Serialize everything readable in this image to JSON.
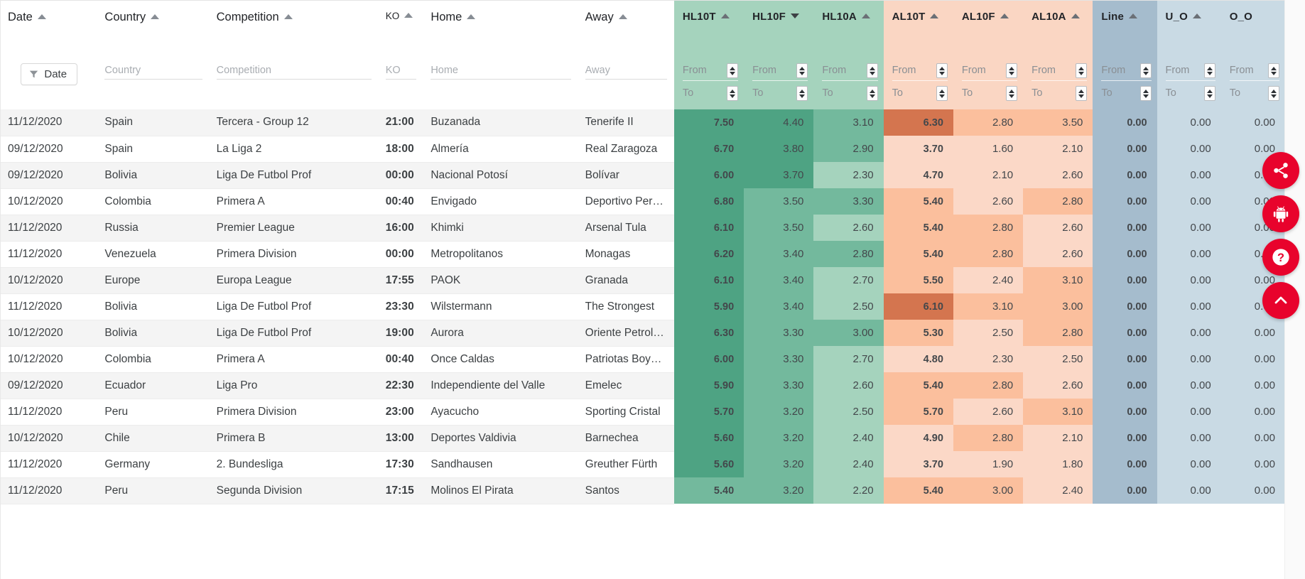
{
  "columns": {
    "text": [
      {
        "key": "date",
        "label": "Date",
        "sort": "asc",
        "filter_placeholder": "Date"
      },
      {
        "key": "country",
        "label": "Country",
        "sort": "asc",
        "filter_placeholder": "Country"
      },
      {
        "key": "competition",
        "label": "Competition",
        "sort": "asc",
        "filter_placeholder": "Competition"
      },
      {
        "key": "ko",
        "label": "KO",
        "sort": "asc",
        "filter_placeholder": "KO"
      },
      {
        "key": "home",
        "label": "Home",
        "sort": "asc",
        "filter_placeholder": "Home"
      },
      {
        "key": "away",
        "label": "Away",
        "sort": "asc",
        "filter_placeholder": "Away"
      }
    ],
    "numeric": [
      {
        "key": "hl10t",
        "label": "HL10T",
        "sort": "asc",
        "group": "green"
      },
      {
        "key": "hl10f",
        "label": "HL10F",
        "sort": "desc",
        "group": "green"
      },
      {
        "key": "hl10a",
        "label": "HL10A",
        "sort": "asc",
        "group": "green"
      },
      {
        "key": "al10t",
        "label": "AL10T",
        "sort": "asc",
        "group": "orange"
      },
      {
        "key": "al10f",
        "label": "AL10F",
        "sort": "asc",
        "group": "orange"
      },
      {
        "key": "al10a",
        "label": "AL10A",
        "sort": "asc",
        "group": "orange"
      },
      {
        "key": "line",
        "label": "Line",
        "sort": "asc",
        "group": "blue"
      },
      {
        "key": "u_o",
        "label": "U_O",
        "sort": "asc",
        "group": "blue2"
      },
      {
        "key": "o_o",
        "label": "O_O",
        "sort": "none",
        "group": "blue2"
      }
    ],
    "filter_from": "From",
    "filter_to": "To",
    "date_filter_button": "Date"
  },
  "rows": [
    {
      "date": "11/12/2020",
      "country": "Spain",
      "competition": "Tercera - Group 12",
      "ko": "21:00",
      "home": "Buzanada",
      "away": "Tenerife II",
      "hl10t": "7.50",
      "hl10f": "4.40",
      "hl10a": "3.10",
      "al10t": "6.30",
      "al10f": "2.80",
      "al10a": "3.50",
      "line": "0.00",
      "u_o": "0.00",
      "o_o": "0.00"
    },
    {
      "date": "09/12/2020",
      "country": "Spain",
      "competition": "La Liga 2",
      "ko": "18:00",
      "home": "Almería",
      "away": "Real Zaragoza",
      "hl10t": "6.70",
      "hl10f": "3.80",
      "hl10a": "2.90",
      "al10t": "3.70",
      "al10f": "1.60",
      "al10a": "2.10",
      "line": "0.00",
      "u_o": "0.00",
      "o_o": "0.00"
    },
    {
      "date": "09/12/2020",
      "country": "Bolivia",
      "competition": "Liga De Futbol Prof",
      "ko": "00:00",
      "home": "Nacional Potosí",
      "away": "Bolívar",
      "hl10t": "6.00",
      "hl10f": "3.70",
      "hl10a": "2.30",
      "al10t": "4.70",
      "al10f": "2.10",
      "al10a": "2.60",
      "line": "0.00",
      "u_o": "0.00",
      "o_o": "0.00"
    },
    {
      "date": "10/12/2020",
      "country": "Colombia",
      "competition": "Primera A",
      "ko": "00:40",
      "home": "Envigado",
      "away": "Deportivo Pereira",
      "hl10t": "6.80",
      "hl10f": "3.50",
      "hl10a": "3.30",
      "al10t": "5.40",
      "al10f": "2.60",
      "al10a": "2.80",
      "line": "0.00",
      "u_o": "0.00",
      "o_o": "0.00"
    },
    {
      "date": "11/12/2020",
      "country": "Russia",
      "competition": "Premier League",
      "ko": "16:00",
      "home": "Khimki",
      "away": "Arsenal Tula",
      "hl10t": "6.10",
      "hl10f": "3.50",
      "hl10a": "2.60",
      "al10t": "5.40",
      "al10f": "2.80",
      "al10a": "2.60",
      "line": "0.00",
      "u_o": "0.00",
      "o_o": "0.00"
    },
    {
      "date": "11/12/2020",
      "country": "Venezuela",
      "competition": "Primera Division",
      "ko": "00:00",
      "home": "Metropolitanos",
      "away": "Monagas",
      "hl10t": "6.20",
      "hl10f": "3.40",
      "hl10a": "2.80",
      "al10t": "5.40",
      "al10f": "2.80",
      "al10a": "2.60",
      "line": "0.00",
      "u_o": "0.00",
      "o_o": "0.00"
    },
    {
      "date": "10/12/2020",
      "country": "Europe",
      "competition": "Europa League",
      "ko": "17:55",
      "home": "PAOK",
      "away": "Granada",
      "hl10t": "6.10",
      "hl10f": "3.40",
      "hl10a": "2.70",
      "al10t": "5.50",
      "al10f": "2.40",
      "al10a": "3.10",
      "line": "0.00",
      "u_o": "0.00",
      "o_o": "0.00"
    },
    {
      "date": "11/12/2020",
      "country": "Bolivia",
      "competition": "Liga De Futbol Prof",
      "ko": "23:30",
      "home": "Wilstermann",
      "away": "The Strongest",
      "hl10t": "5.90",
      "hl10f": "3.40",
      "hl10a": "2.50",
      "al10t": "6.10",
      "al10f": "3.10",
      "al10a": "3.00",
      "line": "0.00",
      "u_o": "0.00",
      "o_o": "0.00"
    },
    {
      "date": "10/12/2020",
      "country": "Bolivia",
      "competition": "Liga De Futbol Prof",
      "ko": "19:00",
      "home": "Aurora",
      "away": "Oriente Petrolero",
      "hl10t": "6.30",
      "hl10f": "3.30",
      "hl10a": "3.00",
      "al10t": "5.30",
      "al10f": "2.50",
      "al10a": "2.80",
      "line": "0.00",
      "u_o": "0.00",
      "o_o": "0.00"
    },
    {
      "date": "10/12/2020",
      "country": "Colombia",
      "competition": "Primera A",
      "ko": "00:40",
      "home": "Once Caldas",
      "away": "Patriotas Boyacá",
      "hl10t": "6.00",
      "hl10f": "3.30",
      "hl10a": "2.70",
      "al10t": "4.80",
      "al10f": "2.30",
      "al10a": "2.50",
      "line": "0.00",
      "u_o": "0.00",
      "o_o": "0.00"
    },
    {
      "date": "09/12/2020",
      "country": "Ecuador",
      "competition": "Liga Pro",
      "ko": "22:30",
      "home": "Independiente del Valle",
      "away": "Emelec",
      "hl10t": "5.90",
      "hl10f": "3.30",
      "hl10a": "2.60",
      "al10t": "5.40",
      "al10f": "2.80",
      "al10a": "2.60",
      "line": "0.00",
      "u_o": "0.00",
      "o_o": "0.00"
    },
    {
      "date": "11/12/2020",
      "country": "Peru",
      "competition": "Primera Division",
      "ko": "23:00",
      "home": "Ayacucho",
      "away": "Sporting Cristal",
      "hl10t": "5.70",
      "hl10f": "3.20",
      "hl10a": "2.50",
      "al10t": "5.70",
      "al10f": "2.60",
      "al10a": "3.10",
      "line": "0.00",
      "u_o": "0.00",
      "o_o": "0.00"
    },
    {
      "date": "10/12/2020",
      "country": "Chile",
      "competition": "Primera B",
      "ko": "13:00",
      "home": "Deportes Valdivia",
      "away": "Barnechea",
      "hl10t": "5.60",
      "hl10f": "3.20",
      "hl10a": "2.40",
      "al10t": "4.90",
      "al10f": "2.80",
      "al10a": "2.10",
      "line": "0.00",
      "u_o": "0.00",
      "o_o": "0.00"
    },
    {
      "date": "11/12/2020",
      "country": "Germany",
      "competition": "2. Bundesliga",
      "ko": "17:30",
      "home": "Sandhausen",
      "away": "Greuther Fürth",
      "hl10t": "5.60",
      "hl10f": "3.20",
      "hl10a": "2.40",
      "al10t": "3.70",
      "al10f": "1.90",
      "al10a": "1.80",
      "line": "0.00",
      "u_o": "0.00",
      "o_o": "0.00"
    },
    {
      "date": "11/12/2020",
      "country": "Peru",
      "competition": "Segunda Division",
      "ko": "17:15",
      "home": "Molinos El Pirata",
      "away": "Santos",
      "hl10t": "5.40",
      "hl10f": "3.20",
      "hl10a": "2.20",
      "al10t": "5.40",
      "al10f": "3.00",
      "al10a": "2.40",
      "line": "0.00",
      "u_o": "0.00",
      "o_o": "0.00"
    }
  ],
  "heat_colors": {
    "green_dark": "#4ea383",
    "green_mid": "#73b99d",
    "green_light": "#a5d3bd",
    "orange_dark": "#d4754f",
    "orange_mid": "#fbbf9d",
    "orange_light": "#fbd8c7",
    "blue": "#a5bccd",
    "blue_light": "#c9dae4"
  },
  "cell_shades": {
    "hl10t": [
      "green_dark",
      "green_dark",
      "green_dark",
      "green_dark",
      "green_dark",
      "green_dark",
      "green_dark",
      "green_dark",
      "green_dark",
      "green_dark",
      "green_dark",
      "green_dark",
      "green_dark",
      "green_dark",
      "green_mid"
    ],
    "hl10f": [
      "green_dark",
      "green_dark",
      "green_dark",
      "green_mid",
      "green_mid",
      "green_mid",
      "green_mid",
      "green_mid",
      "green_mid",
      "green_mid",
      "green_mid",
      "green_mid",
      "green_mid",
      "green_mid",
      "green_mid"
    ],
    "hl10a": [
      "green_mid",
      "green_mid",
      "green_light",
      "green_mid",
      "green_light",
      "green_mid",
      "green_light",
      "green_light",
      "green_mid",
      "green_light",
      "green_light",
      "green_light",
      "green_light",
      "green_light",
      "green_light"
    ],
    "al10t": [
      "orange_dark",
      "orange_light",
      "orange_light",
      "orange_mid",
      "orange_mid",
      "orange_mid",
      "orange_mid",
      "orange_dark",
      "orange_mid",
      "orange_light",
      "orange_mid",
      "orange_mid",
      "orange_light",
      "orange_light",
      "orange_mid"
    ],
    "al10f": [
      "orange_mid",
      "orange_light",
      "orange_light",
      "orange_light",
      "orange_mid",
      "orange_mid",
      "orange_light",
      "orange_mid",
      "orange_light",
      "orange_light",
      "orange_mid",
      "orange_light",
      "orange_mid",
      "orange_light",
      "orange_mid"
    ],
    "al10a": [
      "orange_mid",
      "orange_light",
      "orange_light",
      "orange_mid",
      "orange_light",
      "orange_light",
      "orange_mid",
      "orange_mid",
      "orange_mid",
      "orange_light",
      "orange_light",
      "orange_mid",
      "orange_light",
      "orange_light",
      "orange_light"
    ],
    "line": [
      "blue",
      "blue",
      "blue",
      "blue",
      "blue",
      "blue",
      "blue",
      "blue",
      "blue",
      "blue",
      "blue",
      "blue",
      "blue",
      "blue",
      "blue"
    ],
    "u_o": [
      "blue_light",
      "blue_light",
      "blue_light",
      "blue_light",
      "blue_light",
      "blue_light",
      "blue_light",
      "blue_light",
      "blue_light",
      "blue_light",
      "blue_light",
      "blue_light",
      "blue_light",
      "blue_light",
      "blue_light"
    ],
    "o_o": [
      "blue_light",
      "blue_light",
      "blue_light",
      "blue_light",
      "blue_light",
      "blue_light",
      "blue_light",
      "blue_light",
      "blue_light",
      "blue_light",
      "blue_light",
      "blue_light",
      "blue_light",
      "blue_light",
      "blue_light"
    ]
  },
  "fabs": [
    {
      "name": "share-fab",
      "icon": "share-icon",
      "color": "#e8032c"
    },
    {
      "name": "android-fab",
      "icon": "android-icon",
      "color": "#e8032c"
    },
    {
      "name": "help-fab",
      "icon": "help-icon",
      "color": "#e8032c"
    },
    {
      "name": "scroll-top-fab",
      "icon": "chevron-up-icon",
      "color": "#e8032c"
    }
  ]
}
